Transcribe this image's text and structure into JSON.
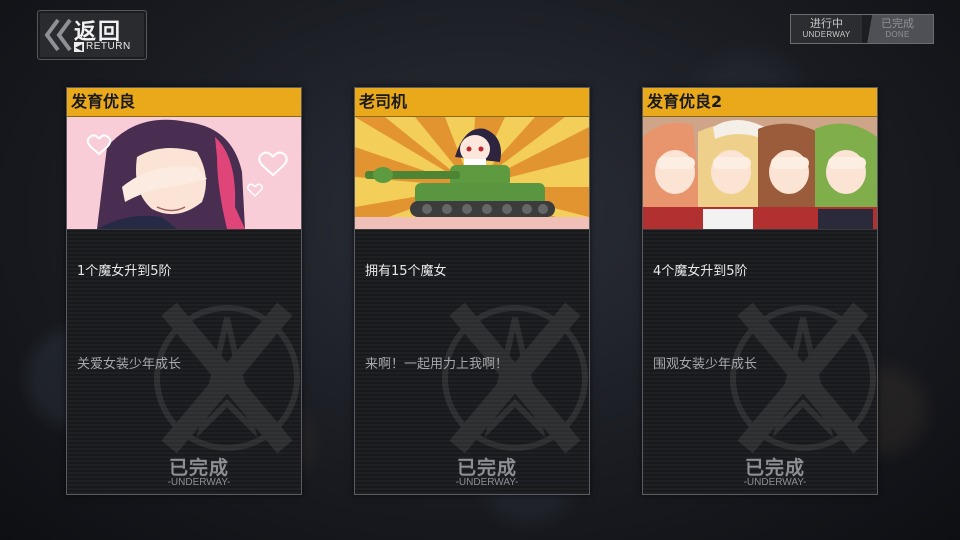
{
  "back_button": {
    "label": "返回",
    "sublabel": "RETURN",
    "sub_icon": "◀"
  },
  "status_toggle": {
    "underway": {
      "label": "进行中",
      "sublabel": "UNDERWAY"
    },
    "done": {
      "label": "已完成",
      "sublabel": "DONE"
    }
  },
  "cards": [
    {
      "title": "发育优良",
      "description": "1个魔女升到5阶",
      "quote": "关爱女装少年成长",
      "status": "已完成",
      "status_sub": "-UNDERWAY-"
    },
    {
      "title": "老司机",
      "description": "拥有15个魔女",
      "quote": "来啊！一起用力上我啊！",
      "status": "已完成",
      "status_sub": "-UNDERWAY-"
    },
    {
      "title": "发育优良2",
      "description": "4个魔女升到5阶",
      "quote": "围观女装少年成长",
      "status": "已完成",
      "status_sub": "-UNDERWAY-"
    }
  ],
  "colors": {
    "header_accent": "#eaa91b",
    "panel": "#1f2023"
  }
}
